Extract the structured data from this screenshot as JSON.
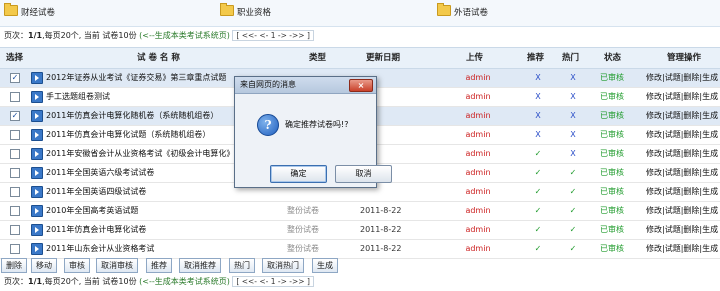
{
  "categories": [
    "财经试卷",
    "职业资格",
    "外语试卷"
  ],
  "pager_top": {
    "label": "页次：",
    "pages": "1/1",
    "per_page": ",每页20个,",
    "current": "当前 试卷10份",
    "generate": "(<--生成本类考试系统页)",
    "nav": "[ <<- <- 1 -> ->> ]"
  },
  "headers": {
    "select": "选择",
    "name": "试 卷 名 称",
    "type": "类型",
    "date": "更新日期",
    "upload": "上传",
    "recommend": "推荐",
    "hot": "热门",
    "status": "状态",
    "manage": "管理操作"
  },
  "rows": [
    {
      "checked": true,
      "title": "2012年证券从业考试《证券交易》第三章重点试题",
      "type": "",
      "date": "",
      "user": "admin",
      "rec": "X",
      "hot": "X",
      "status": "已审核",
      "ops": "修改|试题|删除|生成"
    },
    {
      "checked": false,
      "title": "手工选题组卷测试",
      "type": "",
      "date": "",
      "user": "admin",
      "rec": "X",
      "hot": "X",
      "status": "已审核",
      "ops": "修改|试题|删除|生成"
    },
    {
      "checked": true,
      "title": "2011年仿真会计电算化随机卷（系统随机组卷）",
      "type": "",
      "date": "",
      "user": "admin",
      "rec": "X",
      "hot": "X",
      "status": "已审核",
      "ops": "修改|试题|删除|生成"
    },
    {
      "checked": false,
      "title": "2011年仿真会计电算化试题（系统随机组卷）",
      "type": "",
      "date": "",
      "user": "admin",
      "rec": "X",
      "hot": "X",
      "status": "已审核",
      "ops": "修改|试题|删除|生成"
    },
    {
      "checked": false,
      "title": "2011年安徽省会计从业资格考试《初级会计电算化》",
      "type": "",
      "date": "",
      "user": "admin",
      "rec": "✓",
      "hot": "X",
      "status": "已审核",
      "ops": "修改|试题|删除|生成"
    },
    {
      "checked": false,
      "title": "2011年全国英语六级考试试卷",
      "type": "",
      "date": "",
      "user": "admin",
      "rec": "✓",
      "hot": "✓",
      "status": "已审核",
      "ops": "修改|试题|删除|生成"
    },
    {
      "checked": false,
      "title": "2011年全国英语四级试试卷",
      "type": "",
      "date": "",
      "user": "admin",
      "rec": "✓",
      "hot": "✓",
      "status": "已审核",
      "ops": "修改|试题|删除|生成"
    },
    {
      "checked": false,
      "title": "2010年全国高考英语试题",
      "type": "整份试卷",
      "date": "2011-8-22",
      "user": "admin",
      "rec": "✓",
      "hot": "✓",
      "status": "已审核",
      "ops": "修改|试题|删除|生成"
    },
    {
      "checked": false,
      "title": "2011年仿真会计电算化试卷",
      "type": "整份试卷",
      "date": "2011-8-22",
      "user": "admin",
      "rec": "✓",
      "hot": "✓",
      "status": "已审核",
      "ops": "修改|试题|删除|生成"
    },
    {
      "checked": false,
      "title": "2011年山东会计从业资格考试",
      "type": "整份试卷",
      "date": "2011-8-22",
      "user": "admin",
      "rec": "✓",
      "hot": "✓",
      "status": "已审核",
      "ops": "修改|试题|删除|生成"
    }
  ],
  "toolbar": [
    "删除",
    "移动",
    "审核",
    "取消审核",
    "推荐",
    "取消推荐",
    "热门",
    "取消热门",
    "生成"
  ],
  "pager_bottom": {
    "label": "页次：",
    "pages": "1/1",
    "per_page": ",每页20个,",
    "current": "当前 试卷10份",
    "generate": "(<--生成本类考试系统页)",
    "nav": "[ <<- <- 1 -> ->> ]"
  },
  "dialog": {
    "title": "来自网页的消息",
    "close": "×",
    "icon": "?",
    "message": "确定推荐试卷吗!?",
    "ok": "确定",
    "cancel": "取消"
  }
}
